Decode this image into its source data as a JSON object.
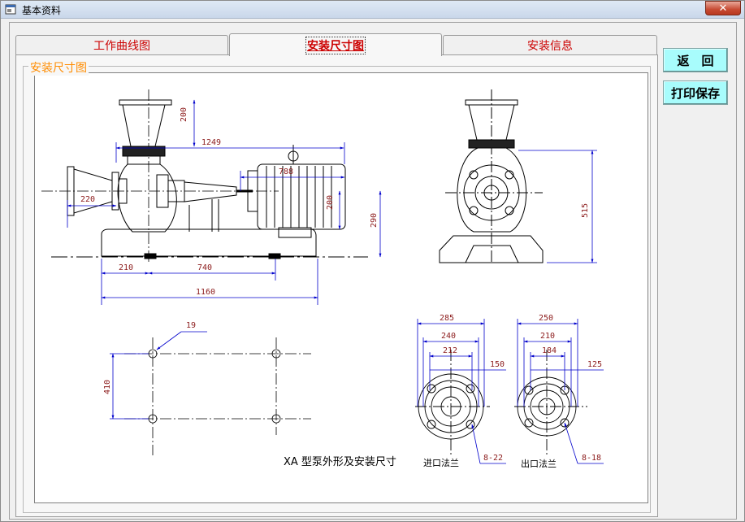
{
  "window": {
    "title": "基本资料",
    "close_symbol": "✕"
  },
  "tabs": [
    {
      "label": "工作曲线图",
      "active": false
    },
    {
      "label": "安装尺寸图",
      "active": true
    },
    {
      "label": "安装信息",
      "active": false
    }
  ],
  "panel": {
    "group_label": "安装尺寸图"
  },
  "buttons": {
    "back": "返　回",
    "print_save": "打印保存"
  },
  "drawing": {
    "caption": "XA 型泵外形及安装尺寸",
    "inlet_label": "进口法兰",
    "outlet_label": "出口法兰",
    "dims": {
      "overall_length": "1249",
      "motor_length": "788",
      "inlet_extension": "220",
      "top_height": "200",
      "motor_height": "200",
      "center_height": "290",
      "base_left": "210",
      "base_mid": "740",
      "base_total": "1160",
      "bolt_dia": "19",
      "bolt_spacing": "410",
      "side_height": "515",
      "inlet_d1": "285",
      "inlet_d2": "240",
      "inlet_d3": "212",
      "inlet_dn": "150",
      "inlet_holes": "8-22",
      "outlet_d1": "250",
      "outlet_d2": "210",
      "outlet_d3": "184",
      "outlet_dn": "125",
      "outlet_holes": "8-18"
    }
  },
  "colors": {
    "tab_text": "#cc0000",
    "group_label": "#ff8c00",
    "dim_line": "#0000cc",
    "dim_text": "#8b1a1a",
    "button_bg": "#a8fcfc"
  }
}
